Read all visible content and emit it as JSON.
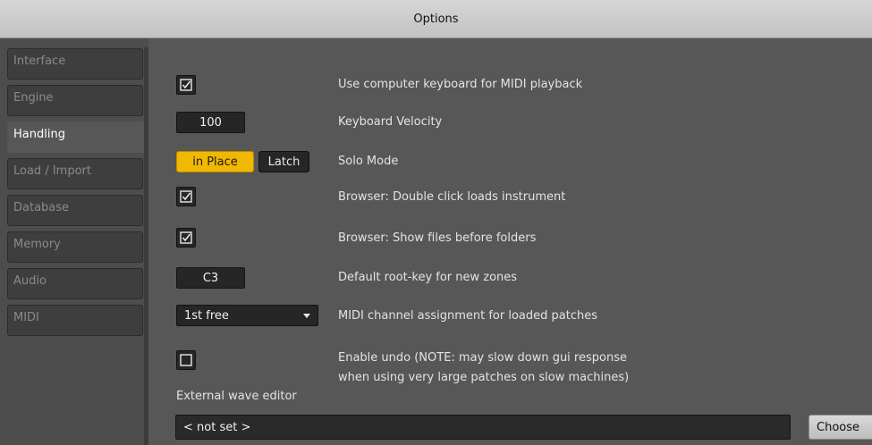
{
  "window": {
    "title": "Options"
  },
  "sidebar": {
    "items": [
      {
        "label": "Interface",
        "active": false
      },
      {
        "label": "Engine",
        "active": false
      },
      {
        "label": "Handling",
        "active": true
      },
      {
        "label": "Load / Import",
        "active": false
      },
      {
        "label": "Database",
        "active": false
      },
      {
        "label": "Memory",
        "active": false
      },
      {
        "label": "Audio",
        "active": false
      },
      {
        "label": "MIDI",
        "active": false
      }
    ]
  },
  "handling": {
    "keyboard_midi": {
      "checked": true,
      "label": "Use computer keyboard for MIDI playback"
    },
    "velocity": {
      "value": "100",
      "label": "Keyboard Velocity"
    },
    "solo": {
      "option_in_place": "in Place",
      "option_latch": "Latch",
      "selected": "in Place",
      "label": "Solo Mode"
    },
    "browser_double_click": {
      "checked": true,
      "label": "Browser: Double click loads instrument"
    },
    "browser_files_first": {
      "checked": true,
      "label": "Browser: Show files before folders"
    },
    "root_key": {
      "value": "C3",
      "label": "Default root-key for new zones"
    },
    "midi_channel": {
      "value": "1st free",
      "label": "MIDI channel assignment for loaded patches"
    },
    "undo": {
      "checked": false,
      "label_line1": "Enable undo (NOTE: may slow down gui response",
      "label_line2": "when using very large patches on slow machines)"
    },
    "external_editor": {
      "label": "External wave editor",
      "value": "< not set >",
      "choose_label": "Choose"
    }
  },
  "colors": {
    "accent": "#f0b800",
    "panel": "#575757",
    "sidebar": "#4d4d4d"
  }
}
